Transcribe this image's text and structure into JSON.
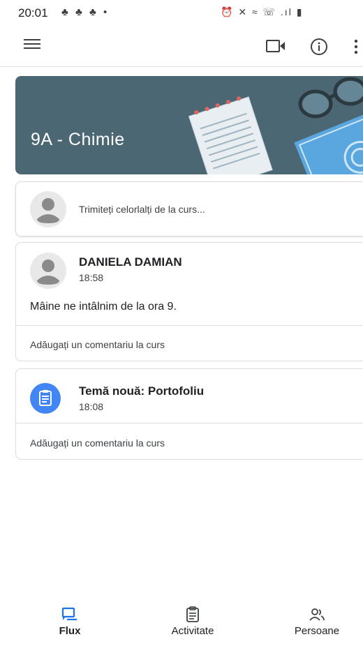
{
  "status": {
    "time": "20:01",
    "notification_glyphs": "♣ ♣ ♣ •",
    "system_glyphs": "⏰ ✕ ≈ ☏ .ıl ▮"
  },
  "appbar": {
    "icons": [
      "menu-icon",
      "video-camera-icon",
      "info-icon",
      "more-vert-icon"
    ]
  },
  "banner": {
    "title": "9A - Chimie",
    "color": "#4c6774"
  },
  "composer": {
    "prompt": "Trimiteți celorlalți de la curs..."
  },
  "posts": [
    {
      "author": "DANIELA DAMIAN",
      "time": "18:58",
      "body": "Mâine ne intâlnim de la ora 9.",
      "comment_prompt": "Adăugați un comentariu la curs"
    },
    {
      "author": "Temă nouă: Portofoliu",
      "time": "18:08",
      "comment_prompt": "Adăugați un comentariu la curs",
      "icon": "assignment-icon",
      "icon_color": "#4285f4"
    }
  ],
  "bottom_nav": {
    "items": [
      {
        "label": "Flux",
        "icon": "stream-icon",
        "active": true
      },
      {
        "label": "Activitate",
        "icon": "assignment-icon",
        "active": false
      },
      {
        "label": "Persoane",
        "icon": "people-icon",
        "active": false
      }
    ],
    "accent": "#1a73e8"
  }
}
